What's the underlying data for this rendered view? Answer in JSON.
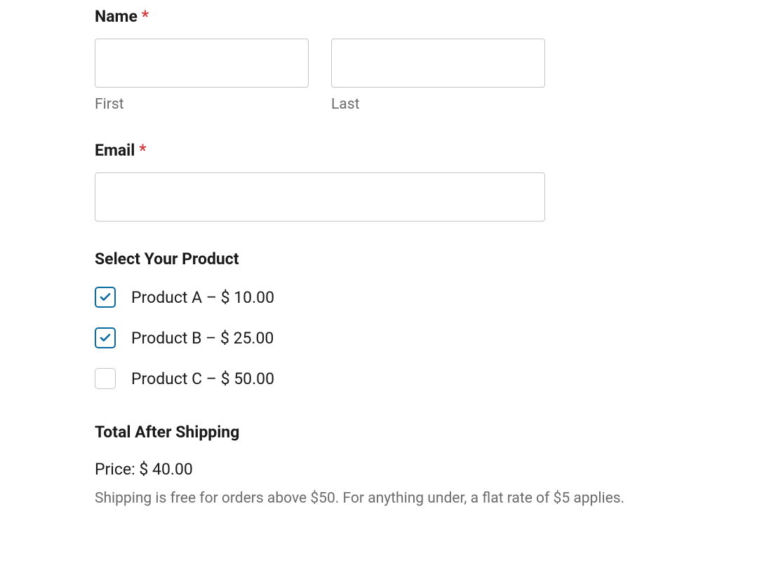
{
  "name": {
    "label": "Name",
    "required": "*",
    "first_sublabel": "First",
    "last_sublabel": "Last",
    "first_value": "",
    "last_value": ""
  },
  "email": {
    "label": "Email",
    "required": "*",
    "value": ""
  },
  "products": {
    "header": "Select Your Product",
    "items": [
      {
        "label": "Product A – $ 10.00",
        "checked": true
      },
      {
        "label": "Product B – $ 25.00",
        "checked": true
      },
      {
        "label": "Product C – $ 50.00",
        "checked": false
      }
    ]
  },
  "total": {
    "header": "Total After Shipping",
    "price_line": "Price: $ 40.00",
    "shipping_note": "Shipping is free for orders above $50. For anything under, a flat rate of $5 applies."
  }
}
